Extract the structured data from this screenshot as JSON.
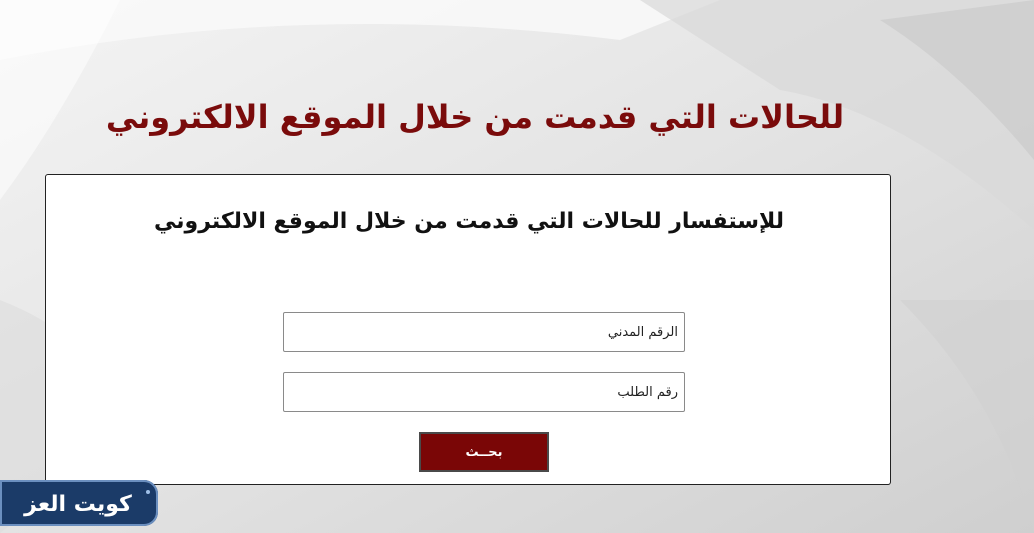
{
  "page": {
    "title": "للحالات التي قدمت من خلال الموقع الالكتروني"
  },
  "form": {
    "heading": "للإستفسار للحالات التي قدمت من خلال الموقع الالكتروني",
    "civil_id": {
      "placeholder": "الرقم المدني"
    },
    "request_number": {
      "placeholder": "رقم الطلب"
    },
    "search_button_label": "بحــث"
  },
  "logo": {
    "text": "كويت العز"
  },
  "colors": {
    "title": "#7a0b0b",
    "button": "#7a0606",
    "logo_bg": "#1b3b68"
  }
}
